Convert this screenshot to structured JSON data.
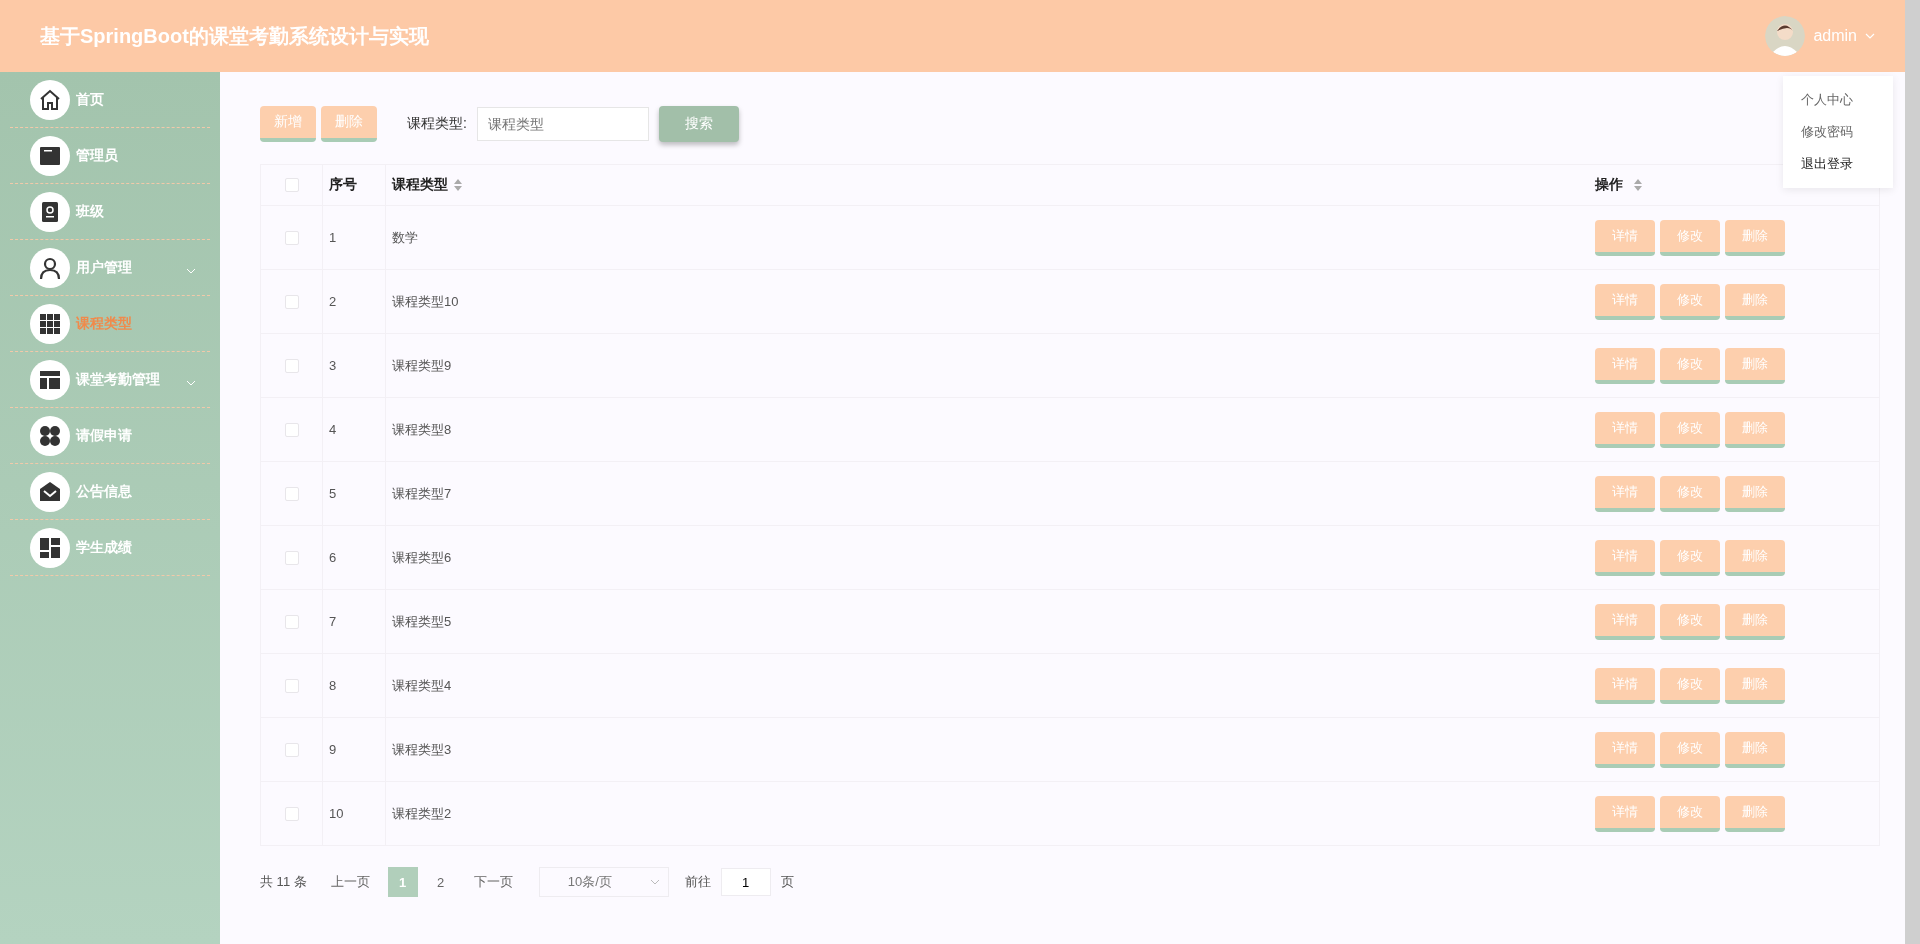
{
  "header": {
    "title": "基于SpringBoot的课堂考勤系统设计与实现",
    "user": "admin"
  },
  "user_menu": {
    "items": [
      {
        "label": "个人中心",
        "hovered": false
      },
      {
        "label": "修改密码",
        "hovered": false
      },
      {
        "label": "退出登录",
        "hovered": true
      }
    ]
  },
  "sidebar": {
    "items": [
      {
        "label": "首页",
        "selected": false,
        "expandable": false
      },
      {
        "label": "管理员",
        "selected": false,
        "expandable": false
      },
      {
        "label": "班级",
        "selected": false,
        "expandable": false
      },
      {
        "label": "用户管理",
        "selected": false,
        "expandable": true
      },
      {
        "label": "课程类型",
        "selected": true,
        "expandable": false
      },
      {
        "label": "课堂考勤管理",
        "selected": false,
        "expandable": true
      },
      {
        "label": "请假申请",
        "selected": false,
        "expandable": false
      },
      {
        "label": "公告信息",
        "selected": false,
        "expandable": false
      },
      {
        "label": "学生成绩",
        "selected": false,
        "expandable": false
      }
    ]
  },
  "toolbar": {
    "buttons": [
      "新增",
      "删除"
    ],
    "filter_label": "课程类型:",
    "filter_placeholder": "课程类型",
    "search_button": "搜索"
  },
  "table": {
    "columns": [
      {
        "label": "序号",
        "sortable": false
      },
      {
        "label": "课程类型",
        "sortable": true
      },
      {
        "label": "操作",
        "sortable": true
      }
    ],
    "header_checked": false,
    "rows": [
      {
        "index": "1",
        "type": "数学",
        "checked": false,
        "actions": [
          "详情",
          "修改",
          "删除"
        ]
      },
      {
        "index": "2",
        "type": "课程类型10",
        "checked": false,
        "actions": [
          "详情",
          "修改",
          "删除"
        ]
      },
      {
        "index": "3",
        "type": "课程类型9",
        "checked": false,
        "actions": [
          "详情",
          "修改",
          "删除"
        ]
      },
      {
        "index": "4",
        "type": "课程类型8",
        "checked": false,
        "actions": [
          "详情",
          "修改",
          "删除"
        ]
      },
      {
        "index": "5",
        "type": "课程类型7",
        "checked": false,
        "actions": [
          "详情",
          "修改",
          "删除"
        ]
      },
      {
        "index": "6",
        "type": "课程类型6",
        "checked": false,
        "actions": [
          "详情",
          "修改",
          "删除"
        ]
      },
      {
        "index": "7",
        "type": "课程类型5",
        "checked": false,
        "actions": [
          "详情",
          "修改",
          "删除"
        ]
      },
      {
        "index": "8",
        "type": "课程类型4",
        "checked": false,
        "actions": [
          "详情",
          "修改",
          "删除"
        ]
      },
      {
        "index": "9",
        "type": "课程类型3",
        "checked": false,
        "actions": [
          "详情",
          "修改",
          "删除"
        ]
      },
      {
        "index": "10",
        "type": "课程类型2",
        "checked": false,
        "actions": [
          "详情",
          "修改",
          "删除"
        ]
      }
    ]
  },
  "pagination": {
    "total": "共 11 条",
    "prev": "上一页",
    "pages": [
      {
        "label": "1",
        "selected": true
      },
      {
        "label": "2",
        "selected": false
      }
    ],
    "next": "下一页",
    "page_size": "10条/页",
    "goto_label": "前往",
    "goto_value": "1",
    "goto_suffix": "页"
  }
}
